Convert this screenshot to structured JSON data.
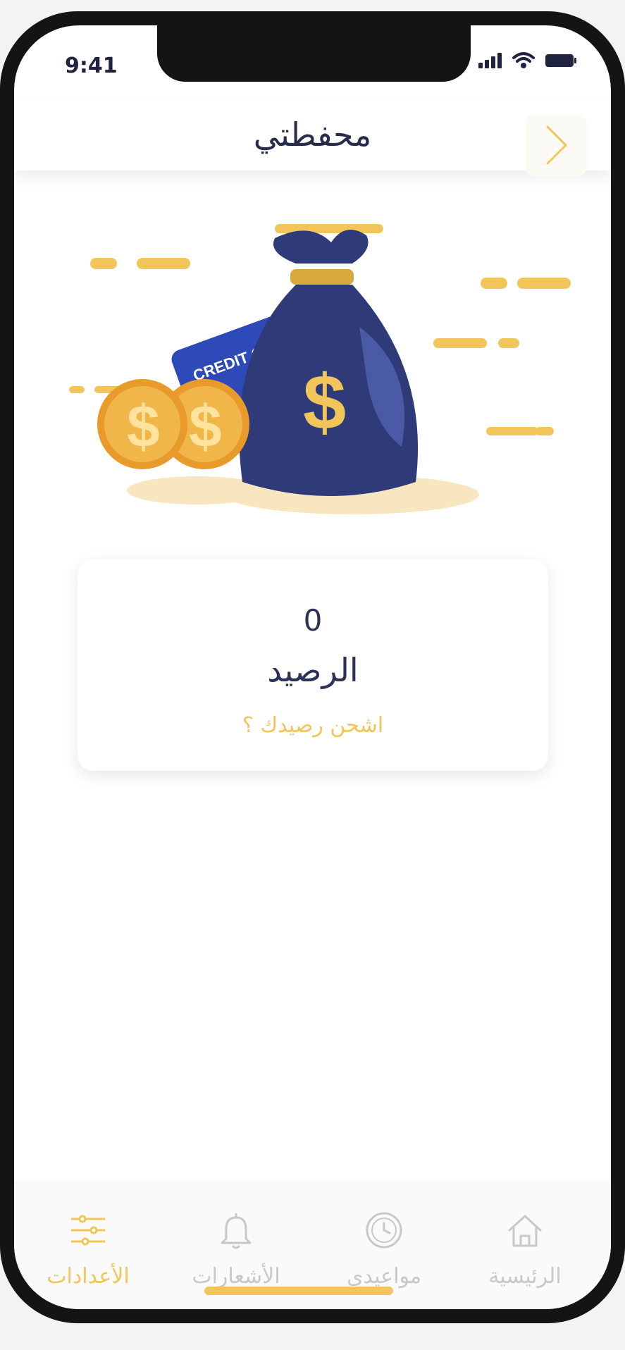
{
  "status_bar": {
    "time": "9:41"
  },
  "header": {
    "title": "محفطتي"
  },
  "illustration": {
    "card_text": "CREDIT CARD",
    "currency_symbol": "$"
  },
  "balance": {
    "value": "0",
    "label": "الرصيد",
    "recharge_link": "اشحن رصيدك ؟"
  },
  "tabs": [
    {
      "label": "الأعدادات",
      "icon": "sliders-icon",
      "active": true
    },
    {
      "label": "الأشعارات",
      "icon": "bell-icon",
      "active": false
    },
    {
      "label": "مواعيدي",
      "icon": "clock-icon",
      "active": false
    },
    {
      "label": "الرئيسية",
      "icon": "home-icon",
      "active": false
    }
  ],
  "colors": {
    "accent": "#f1c55a",
    "text": "#2c3156",
    "inactive": "#c8c8c8"
  }
}
